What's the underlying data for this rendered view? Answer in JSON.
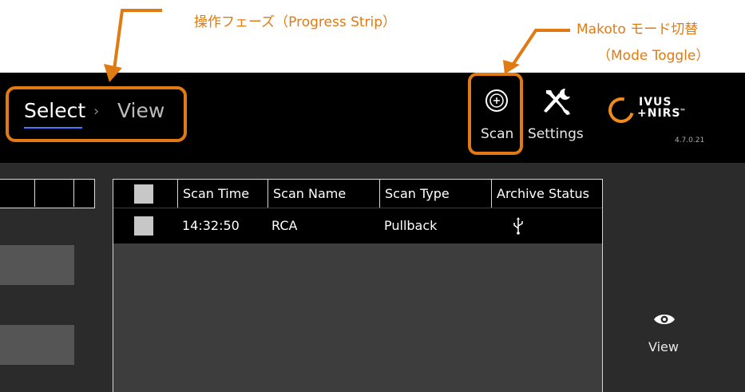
{
  "annotations": {
    "progress_strip": "操作フェーズ（Progress Strip）",
    "mode_toggle_line1": "Makoto モード切替",
    "mode_toggle_line2": "（Mode Toggle）",
    "color": "#e07a12"
  },
  "progress": {
    "step_select": "Select",
    "separator": "›",
    "step_view": "View",
    "active_step": "Select"
  },
  "toolbar": {
    "scan_label": "Scan",
    "settings_label": "Settings"
  },
  "logo": {
    "line1": "IVUS",
    "line2": "+NIRS",
    "tm": "™",
    "version": "4.7.0.21",
    "ring_color": "#f08a1a"
  },
  "table": {
    "headers": [
      "Scan Time",
      "Scan Name",
      "Scan Type",
      "Archive Status"
    ],
    "rows": [
      {
        "time": "14:32:50",
        "name": "RCA",
        "type": "Pullback",
        "archive_icon": "usb-icon"
      }
    ]
  },
  "side": {
    "view_label": "View",
    "view_icon": "eye-icon"
  }
}
